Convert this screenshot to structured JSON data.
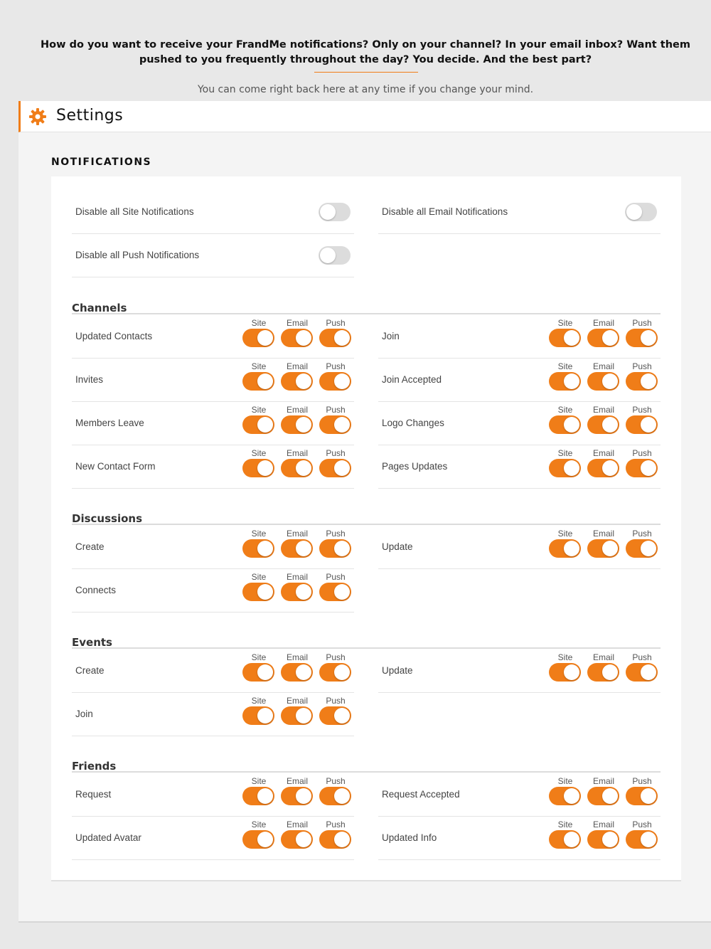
{
  "intro": {
    "title": "How do you want to receive your FrandMe notifications? Only on your channel? In your email inbox? Want them pushed to you frequently throughout the day? You decide. And the best part?",
    "subtitle": "You can come right back here at any time if you change your mind."
  },
  "header": {
    "title": "Settings",
    "icon": "gear-icon",
    "accent": "#f07d18"
  },
  "notifications": {
    "heading": "NOTIFICATIONS",
    "global": [
      {
        "label": "Disable all Site Notifications",
        "enabled": false
      },
      {
        "label": "Disable all Email Notifications",
        "enabled": false
      },
      {
        "label": "Disable all Push Notifications",
        "enabled": false
      }
    ],
    "toggle_labels": [
      "Site",
      "Email",
      "Push"
    ],
    "groups": [
      {
        "title": "Channels",
        "items": [
          {
            "label": "Updated Contacts",
            "site": true,
            "email": true,
            "push": true
          },
          {
            "label": "Join",
            "site": true,
            "email": true,
            "push": true
          },
          {
            "label": "Invites",
            "site": true,
            "email": true,
            "push": true
          },
          {
            "label": "Join Accepted",
            "site": true,
            "email": true,
            "push": true
          },
          {
            "label": "Members Leave",
            "site": true,
            "email": true,
            "push": true
          },
          {
            "label": "Logo Changes",
            "site": true,
            "email": true,
            "push": true
          },
          {
            "label": "New Contact Form",
            "site": true,
            "email": true,
            "push": true
          },
          {
            "label": "Pages Updates",
            "site": true,
            "email": true,
            "push": true
          }
        ]
      },
      {
        "title": "Discussions",
        "items": [
          {
            "label": "Create",
            "site": true,
            "email": true,
            "push": true
          },
          {
            "label": "Update",
            "site": true,
            "email": true,
            "push": true
          },
          {
            "label": "Connects",
            "site": true,
            "email": true,
            "push": true
          }
        ]
      },
      {
        "title": "Events",
        "items": [
          {
            "label": "Create",
            "site": true,
            "email": true,
            "push": true
          },
          {
            "label": "Update",
            "site": true,
            "email": true,
            "push": true
          },
          {
            "label": "Join",
            "site": true,
            "email": true,
            "push": true
          }
        ]
      },
      {
        "title": "Friends",
        "items": [
          {
            "label": "Request",
            "site": true,
            "email": true,
            "push": true
          },
          {
            "label": "Request Accepted",
            "site": true,
            "email": true,
            "push": true
          },
          {
            "label": "Updated Avatar",
            "site": true,
            "email": true,
            "push": true
          },
          {
            "label": "Updated Info",
            "site": true,
            "email": true,
            "push": true
          }
        ]
      }
    ]
  }
}
